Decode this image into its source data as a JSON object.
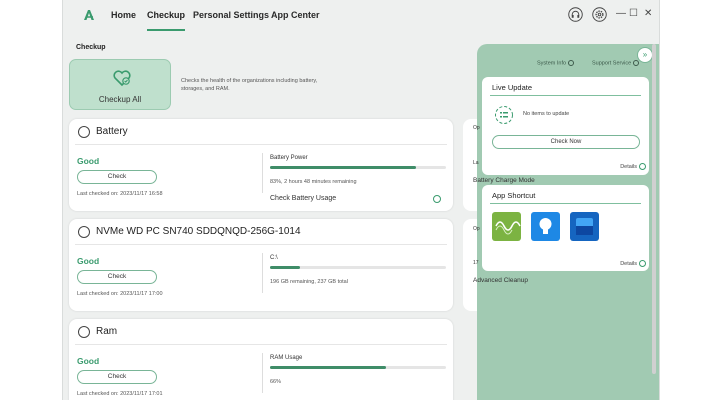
{
  "nav": {
    "items": [
      "Home",
      "Checkup",
      "Personal Settings",
      "App Center"
    ],
    "active": "Checkup"
  },
  "window_controls": {
    "minimize": "—",
    "maximize": "☐",
    "close": "✕"
  },
  "checkup": {
    "section_title": "Checkup",
    "checkup_all_label": "Checkup All",
    "description": "Checks the health of the organizations including battery, storages, and RAM."
  },
  "cards": {
    "battery": {
      "title": "Battery",
      "status": "Good",
      "check_label": "Check",
      "last_checked": "Last checked on: 2023/11/17 16:58",
      "metric_label": "Battery Power",
      "metric_percent": 83,
      "metric_detail": "83%, 2 hours 48 minutes remaining",
      "link_label": "Check Battery Usage"
    },
    "storage": {
      "title": "NVMe WD PC SN740 SDDQNQD-256G-1014",
      "status": "Good",
      "check_label": "Check",
      "last_checked": "Last checked on: 2023/11/17 17:00",
      "metric_label": "C:\\",
      "metric_percent": 17,
      "metric_detail": "196 GB remaining, 237 GB total"
    },
    "ram": {
      "title": "Ram",
      "status": "Good",
      "check_label": "Check",
      "last_checked": "Last checked on: 2023/11/17 17:01",
      "metric_label": "RAM Usage",
      "metric_percent": 66,
      "metric_detail": "66%"
    }
  },
  "behind_panel": {
    "battery_charge_mode": "Battery Charge Mode",
    "advanced_cleanup": "Advanced Cleanup",
    "frag_op1": "Op",
    "frag_la": "La",
    "frag_op2": "Op",
    "frag_17": "17"
  },
  "overlay": {
    "system_info": "System Info",
    "support_service": "Support Service",
    "live_update": {
      "title": "Live Update",
      "empty_text": "No items to update",
      "button": "Check Now",
      "details": "Details"
    },
    "app_shortcut": {
      "title": "App Shortcut",
      "apps": [
        "audio-app-icon",
        "lightbulb-app-icon",
        "blue-app-icon"
      ],
      "details": "Details"
    }
  },
  "colors": {
    "accent": "#3a9b6e",
    "overlay": "#9ec8b0",
    "checkup_all_bg": "#bfe0cd"
  }
}
